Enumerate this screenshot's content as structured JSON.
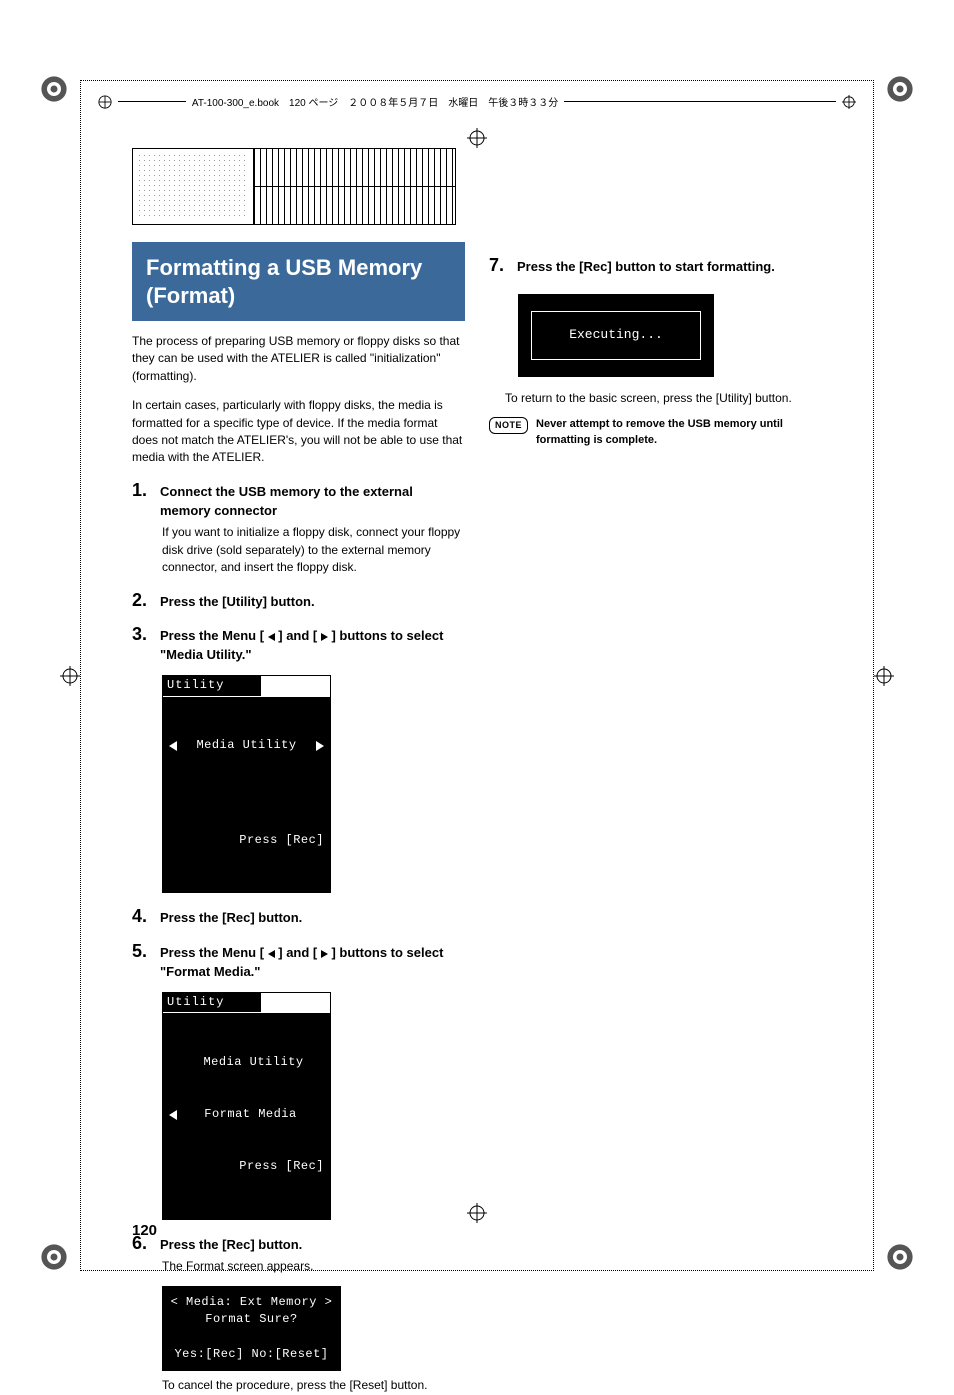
{
  "header": {
    "text": "AT-100-300_e.book　120 ページ　２００８年５月７日　水曜日　午後３時３３分"
  },
  "heading": "Formatting a USB Memory (Format)",
  "intro_p1": "The process of preparing USB memory or floppy disks so that they can be used with the ATELIER is called \"initialization\" (formatting).",
  "intro_p2": "In certain cases, particularly with floppy disks, the media is formatted for a specific type of device. If the media format does not match the ATELIER's, you will not be able to use that media with the ATELIER.",
  "steps": {
    "s1": {
      "num": "1.",
      "title": "Connect the USB memory to the external memory connector",
      "body": "If you want to initialize a floppy disk, connect your floppy disk drive (sold separately) to the external memory connector, and insert the floppy disk."
    },
    "s2": {
      "num": "2.",
      "title": "Press the [Utility] button."
    },
    "s3": {
      "num": "3.",
      "title_a": "Press the Menu [ ",
      "title_b": " ] and [ ",
      "title_c": " ] buttons to select \"Media Utility.\""
    },
    "lcd3": {
      "bar": "Utility",
      "line1": "Media Utility",
      "line2": "Press [Rec]"
    },
    "s4": {
      "num": "4.",
      "title": "Press the [Rec] button."
    },
    "s5": {
      "num": "5.",
      "title_a": "Press the Menu [ ",
      "title_b": " ] and [ ",
      "title_c": " ] buttons to select \"Format Media.\""
    },
    "lcd5": {
      "bar": "Utility",
      "line1": "Media Utility",
      "line2": "Format Media",
      "line3": "Press [Rec]"
    },
    "s6": {
      "num": "6.",
      "title": "Press the [Rec] button.",
      "body": "The Format screen appears."
    },
    "lcd6": {
      "line1": "< Media: Ext Memory >",
      "line2": "Format Sure?",
      "line3": "Yes:[Rec] No:[Reset]"
    },
    "cancel": "To cancel the procedure, press the [Reset] button.",
    "s7": {
      "num": "7.",
      "title": "Press the [Rec] button to start formatting."
    },
    "lcd7": {
      "line1": "Executing..."
    },
    "return": "To return to the basic screen, press the [Utility] button.",
    "note_label": "NOTE",
    "note": "Never attempt to remove the USB memory until formatting is complete."
  },
  "page_number": "120"
}
